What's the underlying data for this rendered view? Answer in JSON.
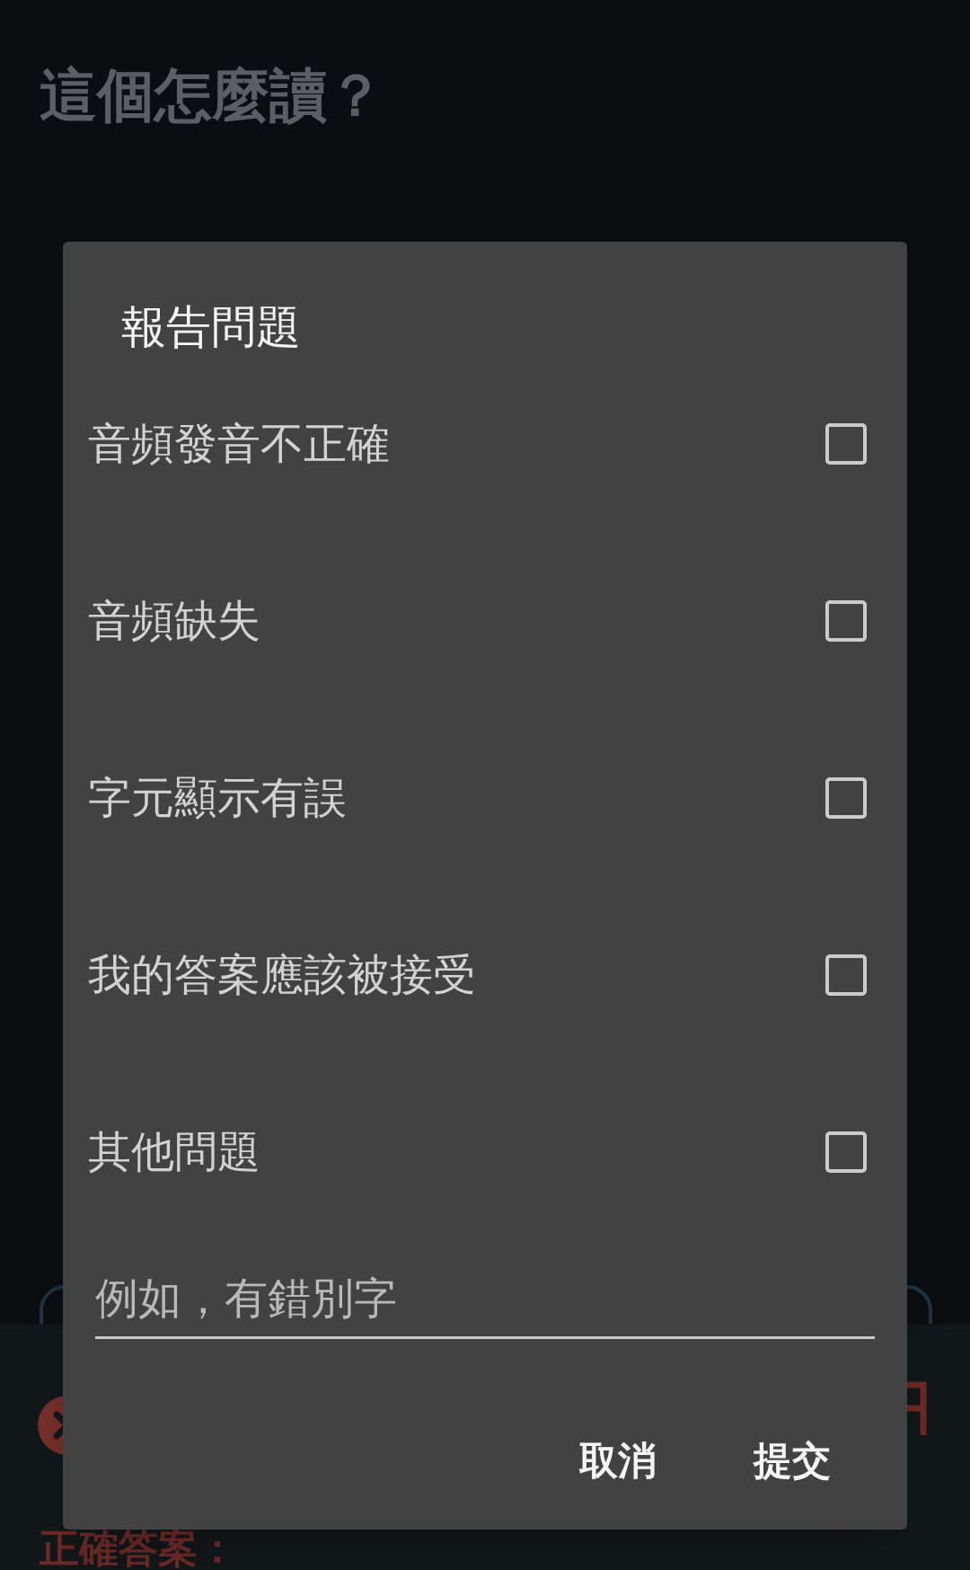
{
  "page": {
    "question_title": "這個怎麼讀？"
  },
  "result_sheet": {
    "correct_answer_label": "正確答案："
  },
  "dialog": {
    "title": "報告問題",
    "options": [
      {
        "label": "音頻發音不正確",
        "checked": false
      },
      {
        "label": "音頻缺失",
        "checked": false
      },
      {
        "label": "字元顯示有誤",
        "checked": false
      },
      {
        "label": "我的答案應該被接受",
        "checked": false
      },
      {
        "label": "其他問題",
        "checked": false
      }
    ],
    "comment_field": {
      "placeholder": "例如，有錯別字"
    },
    "buttons": [
      {
        "label": "取消"
      },
      {
        "label": "提交"
      }
    ]
  }
}
